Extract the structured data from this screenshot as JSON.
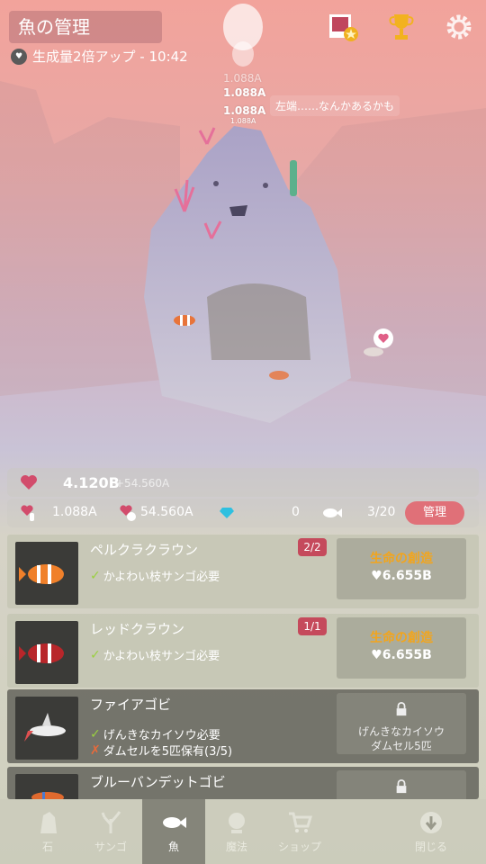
{
  "header": {
    "title": "魚の管理",
    "boost_text": "生成量2倍アップ - 10:42"
  },
  "scene": {
    "floating_values": [
      "1.088A",
      "1.088A",
      "1.088A",
      "1.088A"
    ],
    "hint": "左端……なんかあるかも"
  },
  "stats": {
    "total_hearts": "4.120B",
    "hearts_per_sec": "+54.560A",
    "tap_value": "1.088A",
    "timed_value": "54.560A",
    "gems": "0",
    "fish_count": "3/20",
    "manage_label": "管理"
  },
  "fish_list": [
    {
      "name": "ペルクラクラウン",
      "req1": "かよわい枝サンゴ必要",
      "badge": "2/2",
      "action_title": "生命の創造",
      "cost": "6.655B"
    },
    {
      "name": "レッドクラウン",
      "req1": "かよわい枝サンゴ必要",
      "badge": "1/1",
      "action_title": "生命の創造",
      "cost": "6.655B"
    },
    {
      "name": "ファイアゴビ",
      "req1": "げんきなカイソウ必要",
      "req2": "ダムセルを5匹保有(3/5)",
      "lock1": "げんきなカイソウ",
      "lock2": "ダムセル5匹"
    },
    {
      "name": "ブルーバンデットゴビ"
    }
  ],
  "tabs": [
    "石",
    "サンゴ",
    "魚",
    "魔法",
    "ショップ",
    "閉じる"
  ],
  "colors": {
    "accent": "#e07078",
    "gold": "#f2a51d",
    "check": "#9ad040",
    "cross": "#e86a3a"
  }
}
